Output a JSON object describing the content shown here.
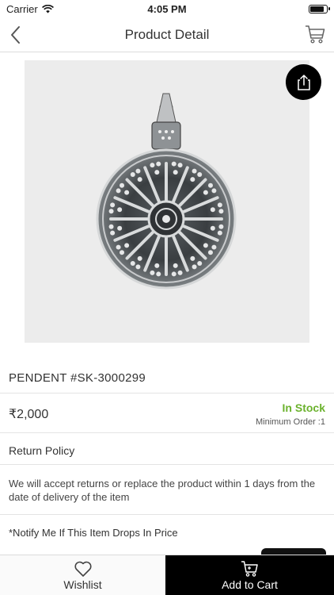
{
  "status_bar": {
    "carrier": "Carrier",
    "time": "4:05 PM",
    "battery_level": 0.9
  },
  "nav": {
    "title": "Product Detail"
  },
  "product": {
    "title": "PENDENT  #SK-3000299",
    "price": "₹2,000",
    "stock": "In Stock",
    "min_order": "Minimum Order :1"
  },
  "return_policy": {
    "heading": "Return Policy",
    "text": "We will accept returns or replace the product within 1 days from the date of delivery of the item"
  },
  "notify": {
    "text": "*Notify Me If This Item Drops In Price"
  },
  "bottom_bar": {
    "wishlist_label": "Wishlist",
    "cart_label": "Add to Cart"
  },
  "colors": {
    "accent_green": "#6bb22d",
    "cart_bg": "#000000"
  },
  "icons": [
    "back-icon",
    "cart-icon",
    "share-icon",
    "heart-icon",
    "wifi-icon",
    "battery-icon"
  ]
}
